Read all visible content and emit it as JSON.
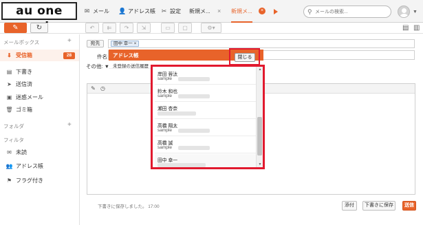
{
  "brand": {
    "logo_text": "au one net",
    "accent_color": "#e8632a",
    "highlight_color": "#e1192e"
  },
  "nav": {
    "tabs": [
      {
        "icon": "mail-icon",
        "label": "メール"
      },
      {
        "icon": "person-icon",
        "label": "アドレス帳"
      },
      {
        "icon": "tools-icon",
        "label": "設定"
      },
      {
        "icon": "",
        "label": "新規メ..."
      },
      {
        "icon": "",
        "label": "新規メ..."
      }
    ],
    "close_glyph": "×"
  },
  "search": {
    "placeholder": "メールの検索..."
  },
  "sidebar": {
    "mailbox_header": "メールボックス",
    "folders_header": "フォルダ",
    "filters_header": "フィルタ",
    "items": [
      {
        "name": "inbox",
        "icon": "inbox-icon",
        "label": "受信箱",
        "badge": "28"
      },
      {
        "name": "drafts",
        "icon": "draft-icon",
        "label": "下書き"
      },
      {
        "name": "sent",
        "icon": "send-icon",
        "label": "送信済"
      },
      {
        "name": "spam",
        "icon": "spam-icon",
        "label": "迷惑メール"
      },
      {
        "name": "trash",
        "icon": "trash-icon",
        "label": "ゴミ箱"
      }
    ],
    "filters": [
      {
        "name": "unread",
        "icon": "envelope-icon",
        "label": "未読"
      },
      {
        "name": "address-book",
        "icon": "people-icon",
        "label": "アドレス帳"
      },
      {
        "name": "flagged",
        "icon": "flag-icon",
        "label": "フラグ付き"
      }
    ]
  },
  "compose": {
    "to_button": "宛先",
    "to_chip": "田中 幸一 ×",
    "subject_label": "件名:",
    "other_label": "その他: ▼",
    "unregistered_label": "未登録の送信履歴",
    "footer_note": "下書きに保存しました。 17:00",
    "attach_button": "添付",
    "save_draft_button": "下書きに保存",
    "send_button": "送信"
  },
  "address_book": {
    "title": "アドレス帳",
    "close_button": "閉じる",
    "entries": [
      {
        "name": "岸田 蓉汰",
        "mail": "sample"
      },
      {
        "name": "鈴木 和也",
        "mail": "sample"
      },
      {
        "name": "瀬田 杏奈",
        "mail": ""
      },
      {
        "name": "高橋 翔太",
        "mail": "sample"
      },
      {
        "name": "高橋 誠",
        "mail": "sample"
      },
      {
        "name": "田中 幸一",
        "mail": ""
      }
    ]
  }
}
